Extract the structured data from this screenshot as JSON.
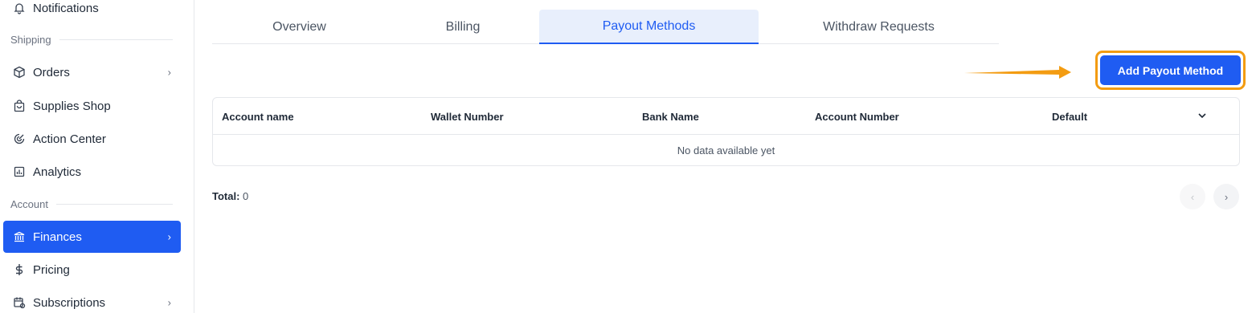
{
  "sidebar": {
    "items": [
      {
        "label": "Notifications",
        "icon": "bell-icon"
      },
      {
        "label": "Orders",
        "icon": "box-icon"
      },
      {
        "label": "Supplies Shop",
        "icon": "shopping-bag-icon"
      },
      {
        "label": "Action Center",
        "icon": "radar-icon"
      },
      {
        "label": "Analytics",
        "icon": "chart-icon"
      },
      {
        "label": "Finances",
        "icon": "bank-icon"
      },
      {
        "label": "Pricing",
        "icon": "dollar-icon"
      },
      {
        "label": "Subscriptions",
        "icon": "calendar-icon"
      }
    ],
    "sections": {
      "shipping": "Shipping",
      "account": "Account"
    },
    "chevron": "›"
  },
  "tabs": [
    {
      "label": "Overview"
    },
    {
      "label": "Billing"
    },
    {
      "label": "Payout Methods",
      "active": true
    },
    {
      "label": "Withdraw Requests"
    }
  ],
  "actions": {
    "add_payout": "Add Payout Method"
  },
  "table": {
    "columns": [
      "Account name",
      "Wallet Number",
      "Bank Name",
      "Account Number",
      "Default"
    ],
    "empty_text": "No data available yet"
  },
  "footer": {
    "total_label": "Total:",
    "total_value": "0"
  },
  "pagination": {
    "prev": "‹",
    "next": "›"
  },
  "colors": {
    "accent": "#1f5cf2",
    "highlight": "#f39c12"
  }
}
